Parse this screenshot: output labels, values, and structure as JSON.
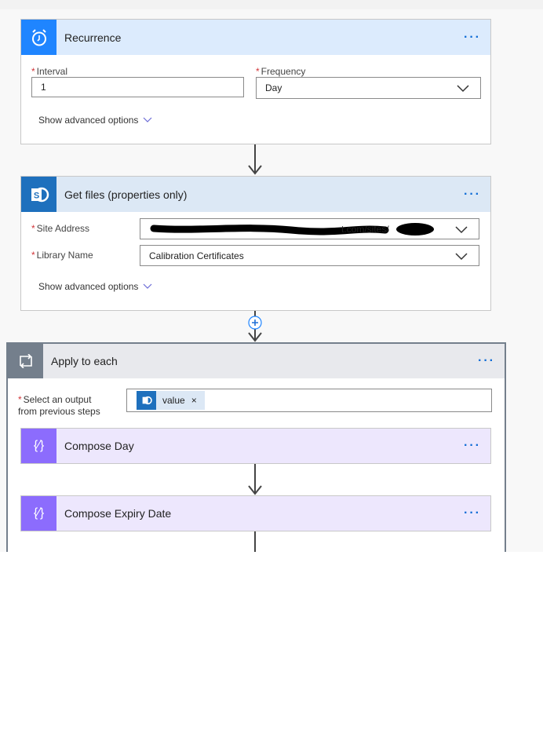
{
  "recurrence": {
    "title": "Recurrence",
    "icon": "alarm-clock-icon",
    "interval_label": "Interval",
    "interval_value": "1",
    "frequency_label": "Frequency",
    "frequency_value": "Day",
    "advanced": "Show advanced options",
    "menu": "···"
  },
  "get_files": {
    "title": "Get files (properties only)",
    "icon": "sharepoint-icon",
    "site_label": "Site Address",
    "site_value_visible": "t.com/sites/",
    "library_label": "Library Name",
    "library_value": "Calibration Certificates",
    "advanced": "Show advanced options",
    "menu": "···"
  },
  "apply_each": {
    "title": "Apply to each",
    "icon": "loop-icon",
    "select_label_1": "Select an output",
    "select_label_2": "from previous steps",
    "token": "value",
    "token_remove": "×",
    "menu": "···"
  },
  "compose_day": {
    "title": "Compose Day",
    "icon": "compose-icon",
    "menu": "···"
  },
  "compose_expiry": {
    "title": "Compose Expiry Date",
    "icon": "compose-icon",
    "menu": "···"
  },
  "colors": {
    "recurrence": "#1f85ff",
    "sharepoint": "#1e70bd",
    "loop": "#747f8c",
    "compose": "#8c6cfd"
  }
}
